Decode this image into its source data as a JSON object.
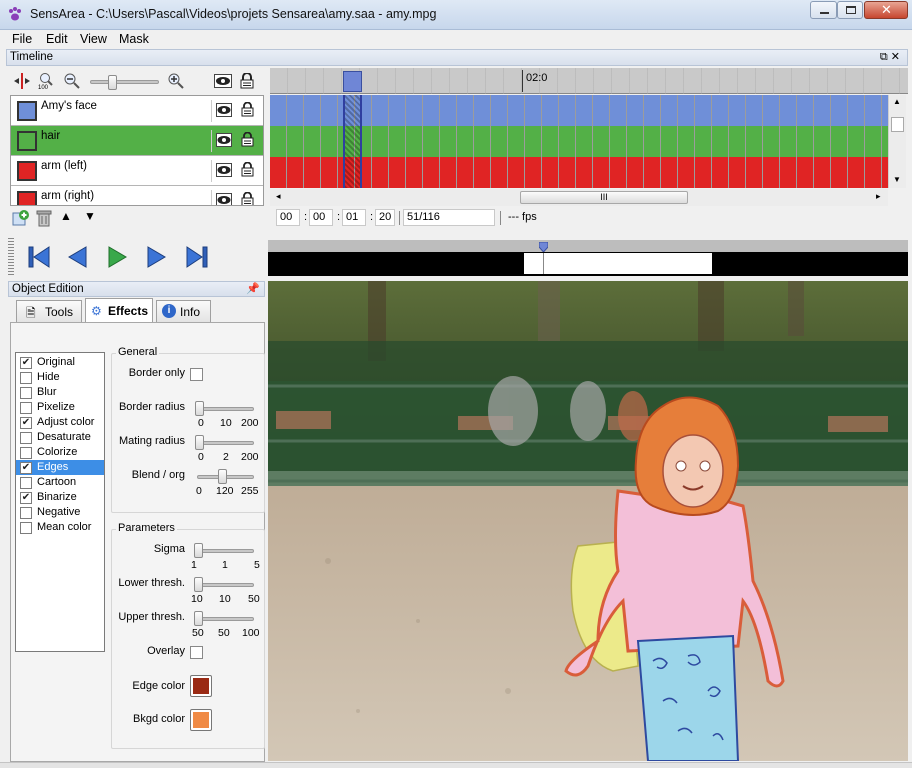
{
  "window": {
    "title": "SensArea - C:\\Users\\Pascal\\Videos\\projets Sensarea\\amy.saa - amy.mpg"
  },
  "menu": [
    "File",
    "Edit",
    "View",
    "Mask"
  ],
  "timeline": {
    "panel_title": "Timeline",
    "time_marker": "02:0",
    "tracks": [
      {
        "name": "Amy's face",
        "color": "#6f8fd8",
        "selected": false
      },
      {
        "name": "hair",
        "color": "#53b047",
        "selected": true
      },
      {
        "name": "arm (left)",
        "color": "#e02424",
        "selected": false
      },
      {
        "name": "arm (right)",
        "color": "#e02424",
        "selected": false
      }
    ],
    "zoom_level": 0.3,
    "timecode": {
      "hh": "00",
      "mm": "00",
      "ss": "01",
      "ff": "20"
    },
    "frame_counter": "51/116",
    "fps": "--- fps",
    "scroll_grip": "III"
  },
  "player": {
    "buttons": [
      "go-to-start",
      "previous-frame",
      "play",
      "next-frame",
      "go-to-end"
    ],
    "position": 0.43
  },
  "object_edition": {
    "panel_title": "Object Edition",
    "tabs": [
      {
        "label": "Tools",
        "active": false
      },
      {
        "label": "Effects",
        "active": true
      },
      {
        "label": "Info",
        "active": false
      }
    ],
    "effects": [
      {
        "label": "Original",
        "checked": true,
        "selected": false
      },
      {
        "label": "Hide",
        "checked": false,
        "selected": false
      },
      {
        "label": "Blur",
        "checked": false,
        "selected": false
      },
      {
        "label": "Pixelize",
        "checked": false,
        "selected": false
      },
      {
        "label": "Adjust color",
        "checked": true,
        "selected": false
      },
      {
        "label": "Desaturate",
        "checked": false,
        "selected": false
      },
      {
        "label": "Colorize",
        "checked": false,
        "selected": false
      },
      {
        "label": "Edges",
        "checked": true,
        "selected": true
      },
      {
        "label": "Cartoon",
        "checked": false,
        "selected": false
      },
      {
        "label": "Binarize",
        "checked": true,
        "selected": false
      },
      {
        "label": "Negative",
        "checked": false,
        "selected": false
      },
      {
        "label": "Mean color",
        "checked": false,
        "selected": false
      }
    ],
    "general": {
      "title": "General",
      "border_only_label": "Border only",
      "border_radius": {
        "label": "Border radius",
        "min": "0",
        "value": "10",
        "max": "200",
        "fraction": 0.0
      },
      "mating_radius": {
        "label": "Mating radius",
        "min": "0",
        "value": "2",
        "max": "200",
        "fraction": 0.0
      },
      "blend": {
        "label": "Blend / org",
        "min": "0",
        "value": "120",
        "max": "255",
        "fraction": 0.47
      }
    },
    "parameters": {
      "title": "Parameters",
      "sigma": {
        "label": "Sigma",
        "min": "1",
        "value": "1",
        "max": "5",
        "fraction": 0.0
      },
      "lower": {
        "label": "Lower thresh.",
        "min": "10",
        "value": "10",
        "max": "50",
        "fraction": 0.0
      },
      "upper": {
        "label": "Upper thresh.",
        "min": "50",
        "value": "50",
        "max": "100",
        "fraction": 0.0
      },
      "overlay_label": "Overlay",
      "edge_color_label": "Edge color",
      "edge_color": "#9a2a14",
      "bkgd_color_label": "Bkgd color",
      "bkgd_color": "#f08a45"
    }
  }
}
